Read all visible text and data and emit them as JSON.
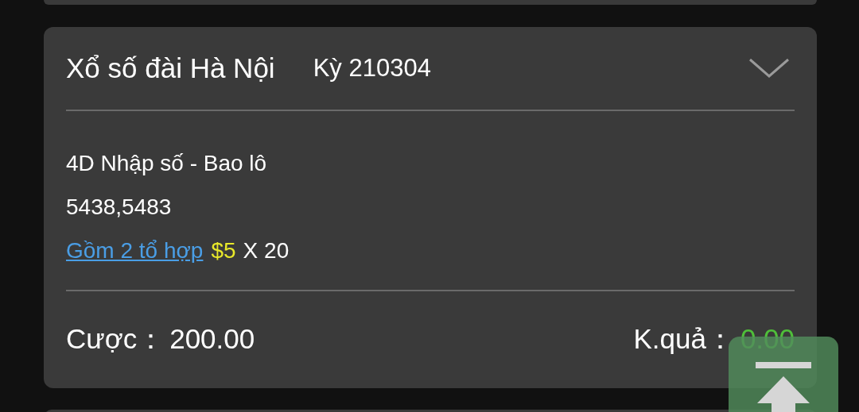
{
  "card": {
    "title": "Xổ số đài Hà Nội",
    "period": "Kỳ 210304"
  },
  "bet": {
    "type": "4D Nhập số - Bao lô",
    "numbers": "5438,5483",
    "combo_link": "Gồm 2 tổ hợp",
    "amount": "$5",
    "multiplier": "X 20"
  },
  "footer": {
    "bet_label": "Cược：",
    "bet_value": "200.00",
    "result_label": "K.quả：",
    "result_value": "0.00"
  }
}
